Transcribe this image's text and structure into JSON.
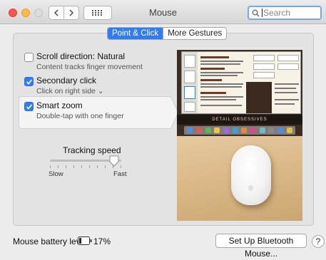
{
  "window": {
    "title": "Mouse",
    "search": {
      "placeholder": "Search",
      "value": ""
    }
  },
  "tabs": [
    {
      "label": "Point & Click",
      "active": true
    },
    {
      "label": "More Gestures",
      "active": false
    }
  ],
  "options": [
    {
      "title": "Scroll direction: Natural",
      "subtitle": "Content tracks finger movement",
      "checked": false
    },
    {
      "title": "Secondary click",
      "subtitle": "Click on right side ⌄",
      "checked": true
    },
    {
      "title": "Smart zoom",
      "subtitle": "Double-tap with one finger",
      "checked": true
    }
  ],
  "tracking": {
    "label": "Tracking speed",
    "min_label": "Slow",
    "max_label": "Fast",
    "level": 0.9
  },
  "preview": {
    "banner_text": "DETAIL OBSESSIVES"
  },
  "footer": {
    "battery_label": "Mouse battery level:",
    "battery_percent": "17%",
    "setup_button": "Set Up Bluetooth Mouse...",
    "help_button": "?"
  },
  "colors": {
    "accent": "#2f7cf6",
    "close": "#fc5753",
    "minimize": "#fdbc40"
  },
  "icons": [
    "close-button",
    "minimize-button",
    "zoom-button",
    "chevron-left-icon",
    "chevron-right-icon",
    "grid-icon",
    "search-icon",
    "checkmark-icon",
    "battery-icon",
    "help-icon"
  ]
}
